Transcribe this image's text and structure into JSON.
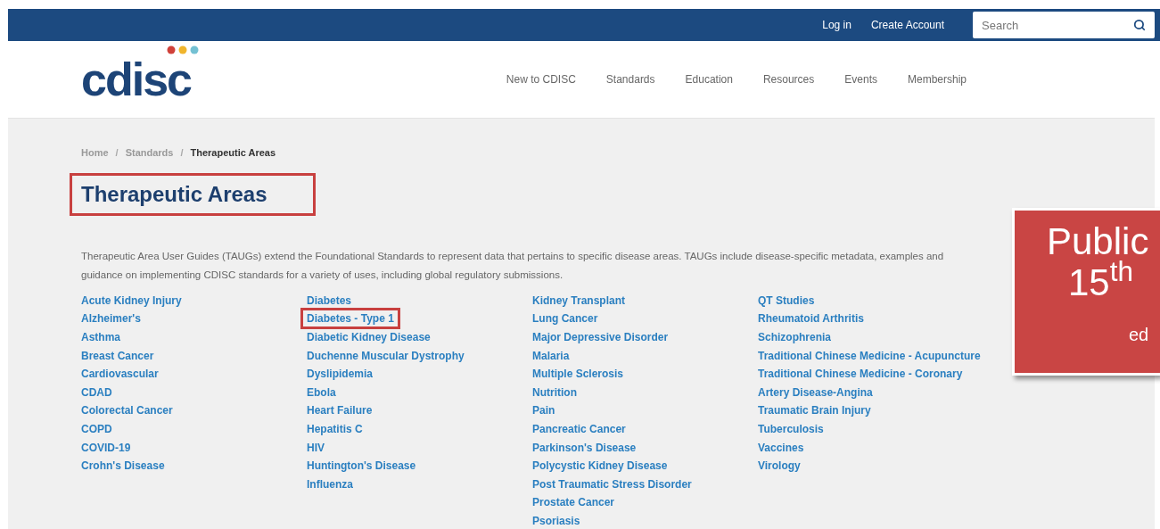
{
  "top_bar": {
    "links": [
      "Log in",
      "Create Account"
    ],
    "search": {
      "placeholder": "Search"
    }
  },
  "header": {
    "logo": "cdisc",
    "nav": [
      "New to CDISC",
      "Standards",
      "Education",
      "Resources",
      "Events",
      "Membership"
    ]
  },
  "breadcrumb": {
    "separator": "/",
    "items": [
      {
        "label": "Home",
        "current": false
      },
      {
        "label": "Standards",
        "current": false
      },
      {
        "label": "Therapeutic Areas",
        "current": true
      }
    ]
  },
  "title": {
    "text": "Therapeutic Areas",
    "highlighted": true
  },
  "description": "Therapeutic Area User Guides (TAUGs) extend the Foundational Standards to represent data that pertains to specific disease areas. TAUGs include disease-specific metadata, examples and guidance on implementing CDISC standards for a variety of uses, including global regulatory submissions.",
  "columns": [
    [
      {
        "label": "Acute Kidney Injury",
        "highlighted": false
      },
      {
        "label": "Alzheimer's",
        "highlighted": false
      },
      {
        "label": "Asthma",
        "highlighted": false
      },
      {
        "label": "Breast Cancer",
        "highlighted": false
      },
      {
        "label": "Cardiovascular",
        "highlighted": false
      },
      {
        "label": "CDAD",
        "highlighted": false
      },
      {
        "label": "Colorectal Cancer",
        "highlighted": false
      },
      {
        "label": "COPD",
        "highlighted": false
      },
      {
        "label": "COVID-19",
        "highlighted": false
      },
      {
        "label": "Crohn's Disease",
        "highlighted": false
      }
    ],
    [
      {
        "label": "Diabetes",
        "highlighted": false
      },
      {
        "label": "Diabetes - Type 1",
        "highlighted": true
      },
      {
        "label": "Diabetic Kidney Disease",
        "highlighted": false
      },
      {
        "label": "Duchenne Muscular Dystrophy",
        "highlighted": false
      },
      {
        "label": "Dyslipidemia",
        "highlighted": false
      },
      {
        "label": "Ebola",
        "highlighted": false
      },
      {
        "label": "Heart Failure",
        "highlighted": false
      },
      {
        "label": "Hepatitis C",
        "highlighted": false
      },
      {
        "label": "HIV",
        "highlighted": false
      },
      {
        "label": "Huntington's Disease",
        "highlighted": false
      },
      {
        "label": "Influenza",
        "highlighted": false
      }
    ],
    [
      {
        "label": "Kidney Transplant",
        "highlighted": false
      },
      {
        "label": "Lung Cancer",
        "highlighted": false
      },
      {
        "label": "Major Depressive Disorder",
        "highlighted": false
      },
      {
        "label": "Malaria",
        "highlighted": false
      },
      {
        "label": "Multiple Sclerosis",
        "highlighted": false
      },
      {
        "label": "Nutrition",
        "highlighted": false
      },
      {
        "label": "Pain",
        "highlighted": false
      },
      {
        "label": "Pancreatic Cancer",
        "highlighted": false
      },
      {
        "label": "Parkinson's Disease",
        "highlighted": false
      },
      {
        "label": "Polycystic Kidney Disease",
        "highlighted": false
      },
      {
        "label": "Post Traumatic Stress Disorder",
        "highlighted": false
      },
      {
        "label": "Prostate Cancer",
        "highlighted": false
      },
      {
        "label": "Psoriasis",
        "highlighted": false
      }
    ],
    [
      {
        "label": "QT Studies",
        "highlighted": false
      },
      {
        "label": "Rheumatoid Arthritis",
        "highlighted": false
      },
      {
        "label": "Schizophrenia",
        "highlighted": false
      },
      {
        "label": "Traditional Chinese Medicine - Acupuncture",
        "highlighted": false
      },
      {
        "label": "Traditional Chinese Medicine - Coronary",
        "highlighted": false
      },
      {
        "label": "Artery Disease-Angina",
        "highlighted": false
      },
      {
        "label": "Traumatic Brain Injury",
        "highlighted": false
      },
      {
        "label": "Tuberculosis",
        "highlighted": false
      },
      {
        "label": "Vaccines",
        "highlighted": false
      },
      {
        "label": "Virology",
        "highlighted": false
      }
    ]
  ],
  "callout": {
    "lines": [
      "Public",
      "15$^{th}$",
      "ed"
    ]
  }
}
